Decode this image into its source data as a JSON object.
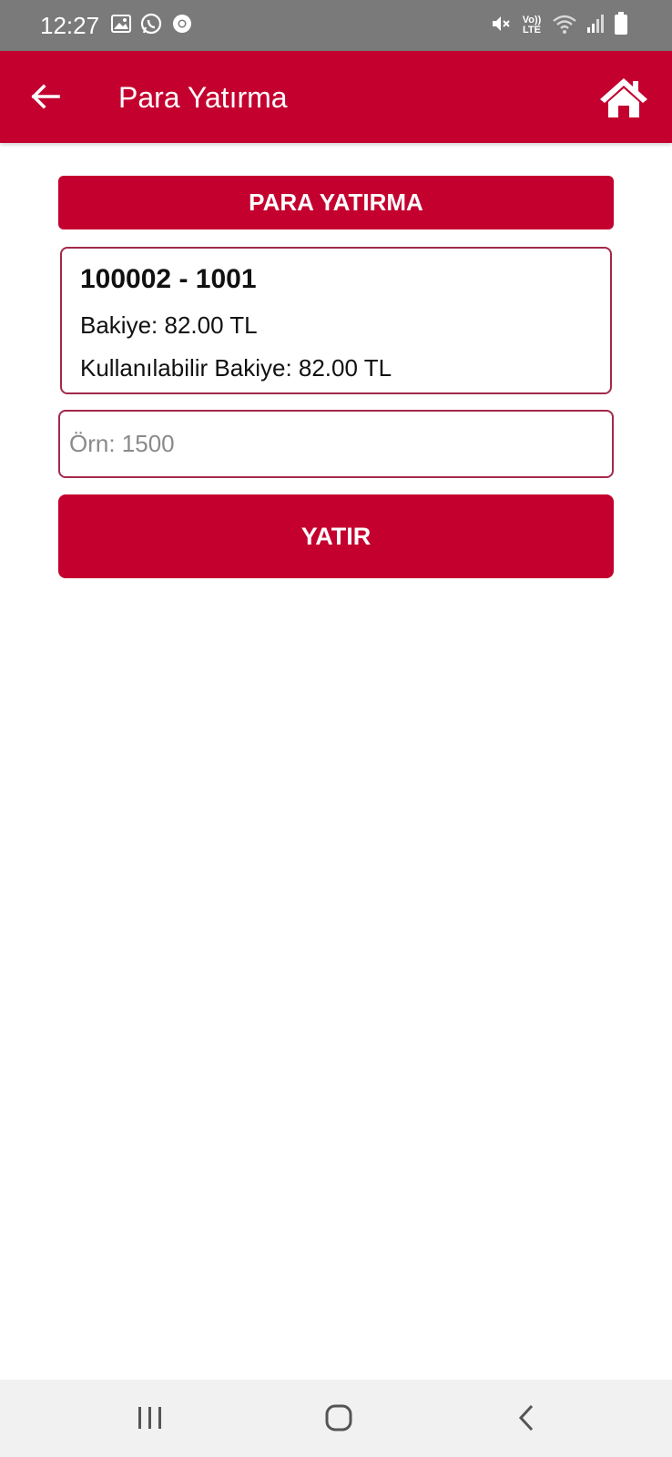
{
  "status_bar": {
    "time": "12:27",
    "left_icons": [
      "image-icon",
      "whatsapp-icon",
      "chrome-icon"
    ],
    "right_icons": [
      "mute-icon",
      "volte-icon",
      "wifi-icon",
      "signal-icon",
      "battery-icon"
    ],
    "volte_label_top": "Vo))",
    "volte_label_bottom": "LTE"
  },
  "app_bar": {
    "title": "Para Yatırma",
    "back_icon": "arrow-left-icon",
    "home_icon": "home-icon",
    "background_color": "#c4002f"
  },
  "section": {
    "header": "PARA YATIRMA"
  },
  "account": {
    "number": "100002 - 1001",
    "balance": "Bakiye: 82.00 TL",
    "available_balance": "Kullanılabilir Bakiye: 82.00 TL"
  },
  "amount_input": {
    "placeholder": "Örn: 1500",
    "value": ""
  },
  "submit": {
    "label": "YATIR"
  },
  "nav_bar": {
    "icons": [
      "recents-icon",
      "home-circle-icon",
      "back-chevron-icon"
    ]
  }
}
